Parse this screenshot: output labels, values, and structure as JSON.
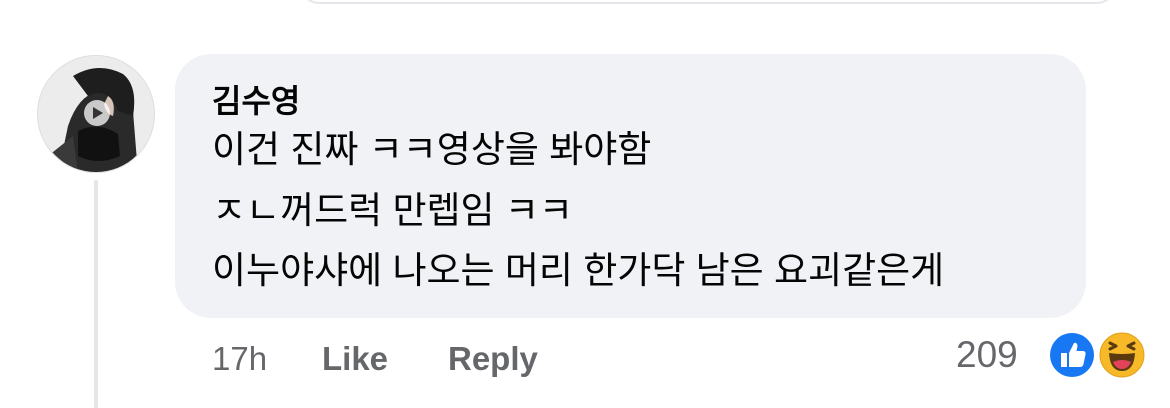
{
  "comment": {
    "author": "김수영",
    "lines": [
      "이건 진짜 ㅋㅋ영상을 봐야함",
      "ㅈㄴ꺼드럭 만렙임 ㅋㅋ",
      "이누야샤에 나오는 머리 한가닥 남은 요괴같은게"
    ],
    "time": "17h",
    "like_label": "Like",
    "reply_label": "Reply",
    "reaction_count": "209",
    "reactions": [
      "like-icon",
      "haha-icon"
    ]
  },
  "colors": {
    "bubble": "#f0f2f5",
    "secondary_text": "#65676b",
    "like_blue": "#1877f2",
    "haha_yellow": "#f7b928"
  }
}
